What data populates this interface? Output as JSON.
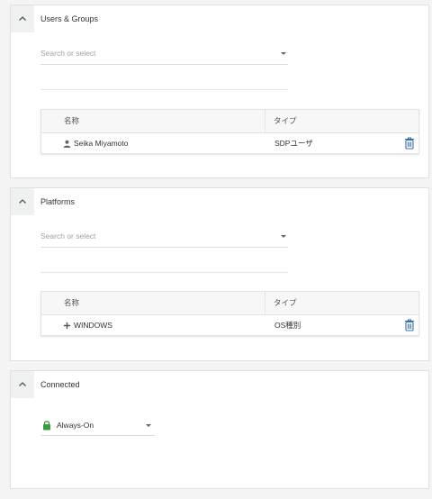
{
  "sections": [
    {
      "title": "Users & Groups",
      "search_placeholder": "Search or select",
      "columns": {
        "name": "名称",
        "type": "タイプ"
      },
      "rows": [
        {
          "icon": "person-icon",
          "name": "Seika Miyamoto",
          "type": "SDPユーザ"
        }
      ]
    },
    {
      "title": "Platforms",
      "search_placeholder": "Search or select",
      "columns": {
        "name": "名称",
        "type": "タイプ"
      },
      "rows": [
        {
          "icon": "plus-icon",
          "name": "WINDOWS",
          "type": "OS種別"
        }
      ]
    },
    {
      "title": "Connected",
      "dropdown": {
        "icon": "lock-icon",
        "value": "Always-On"
      }
    }
  ],
  "colors": {
    "accent": "#3b6ea8",
    "lock": "#3c9a3e",
    "header_tab": "#eef1ef"
  }
}
